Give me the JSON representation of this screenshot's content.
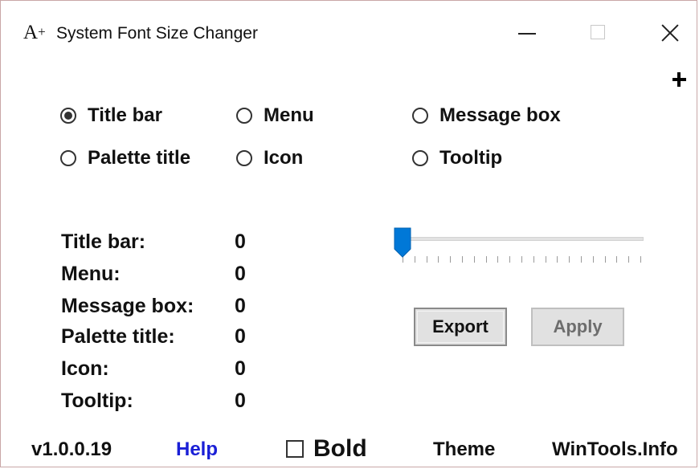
{
  "window": {
    "title": "System Font Size Changer",
    "app_icon_letter": "A",
    "app_icon_plus": "+"
  },
  "radios": [
    {
      "label": "Title bar",
      "checked": true
    },
    {
      "label": "Menu",
      "checked": false
    },
    {
      "label": "Message box",
      "checked": false
    },
    {
      "label": "Palette title",
      "checked": false
    },
    {
      "label": "Icon",
      "checked": false
    },
    {
      "label": "Tooltip",
      "checked": false
    }
  ],
  "values": [
    {
      "label": "Title bar:",
      "value": "0"
    },
    {
      "label": "Menu:",
      "value": "0"
    },
    {
      "label": "Message box:",
      "value": "0"
    },
    {
      "label": "Palette title:",
      "value": "0"
    },
    {
      "label": "Icon:",
      "value": "0"
    },
    {
      "label": "Tooltip:",
      "value": "0"
    }
  ],
  "slider": {
    "value": 0,
    "min": 0,
    "max": 20,
    "tick_count": 21,
    "thumb_color": "#0078d7"
  },
  "buttons": {
    "export": "Export",
    "apply": "Apply"
  },
  "footer": {
    "version": "v1.0.0.19",
    "help": "Help",
    "bold": "Bold",
    "theme": "Theme",
    "site": "WinTools.Info"
  },
  "colors": {
    "help_link": "#1a1fd6",
    "accent": "#0078d7"
  }
}
